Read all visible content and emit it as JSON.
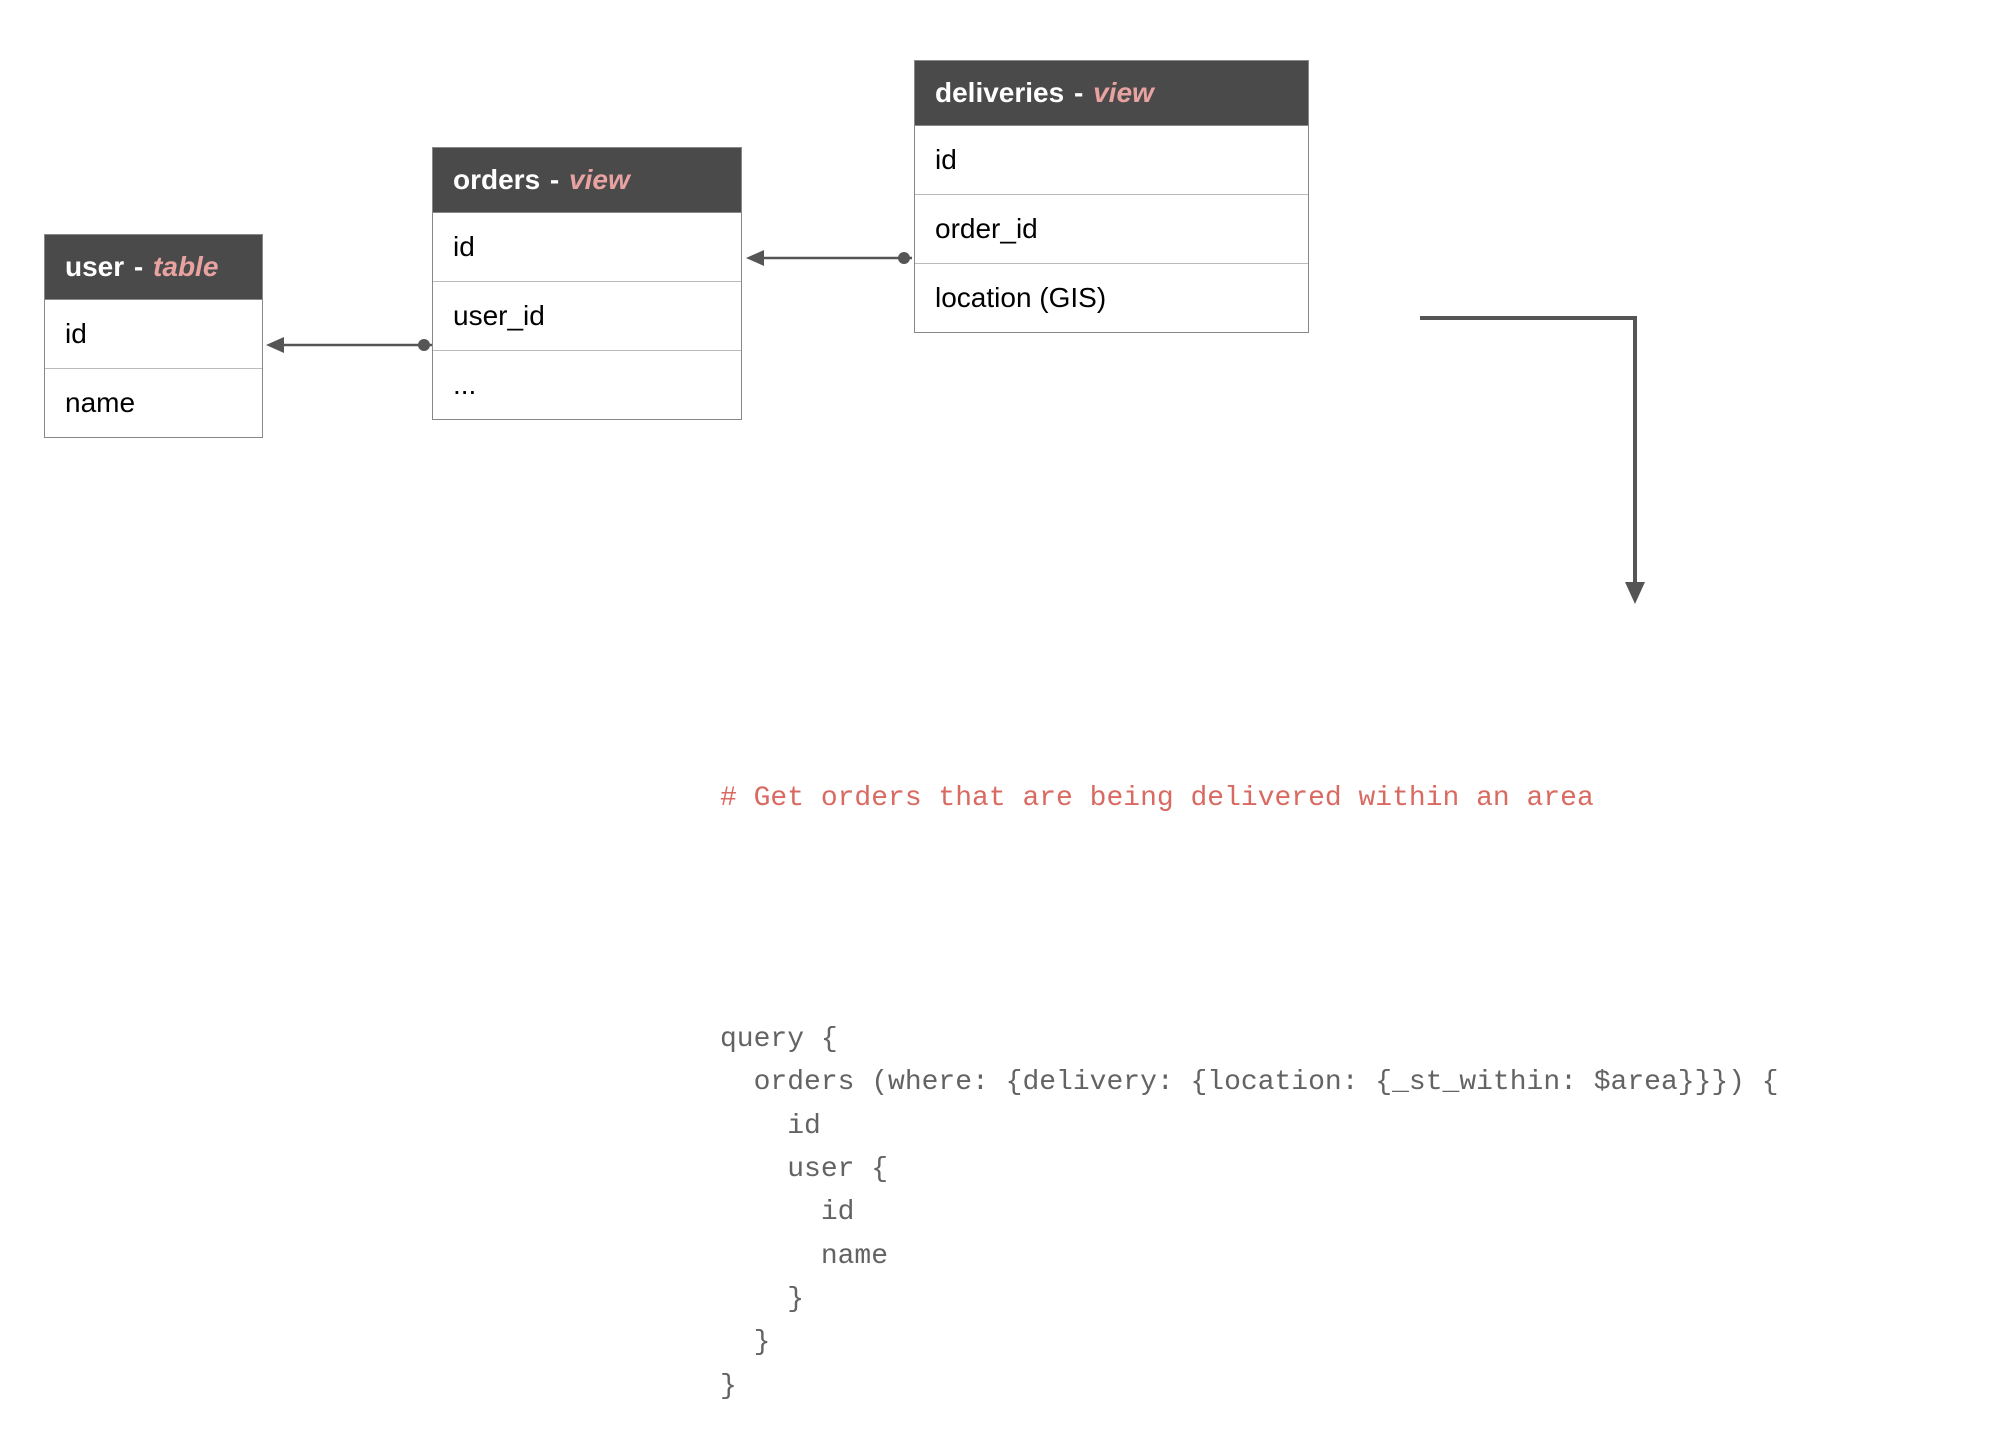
{
  "entities": {
    "user": {
      "name": "user",
      "dash": " - ",
      "type": "table",
      "rows": [
        "id",
        "name"
      ]
    },
    "orders": {
      "name": "orders",
      "dash": " - ",
      "type": "view",
      "rows": [
        "id",
        "user_id",
        "..."
      ]
    },
    "deliveries": {
      "name": "deliveries",
      "dash": "  - ",
      "type": "view",
      "rows": [
        "id",
        "order_id",
        "location (GIS)"
      ]
    }
  },
  "code": {
    "comment": "# Get orders that are being delivered within an area",
    "body": "query {\n  orders (where: {delivery: {location: {_st_within: $area}}}) {\n    id\n    user {\n      id\n      name\n    }\n  }\n}"
  }
}
